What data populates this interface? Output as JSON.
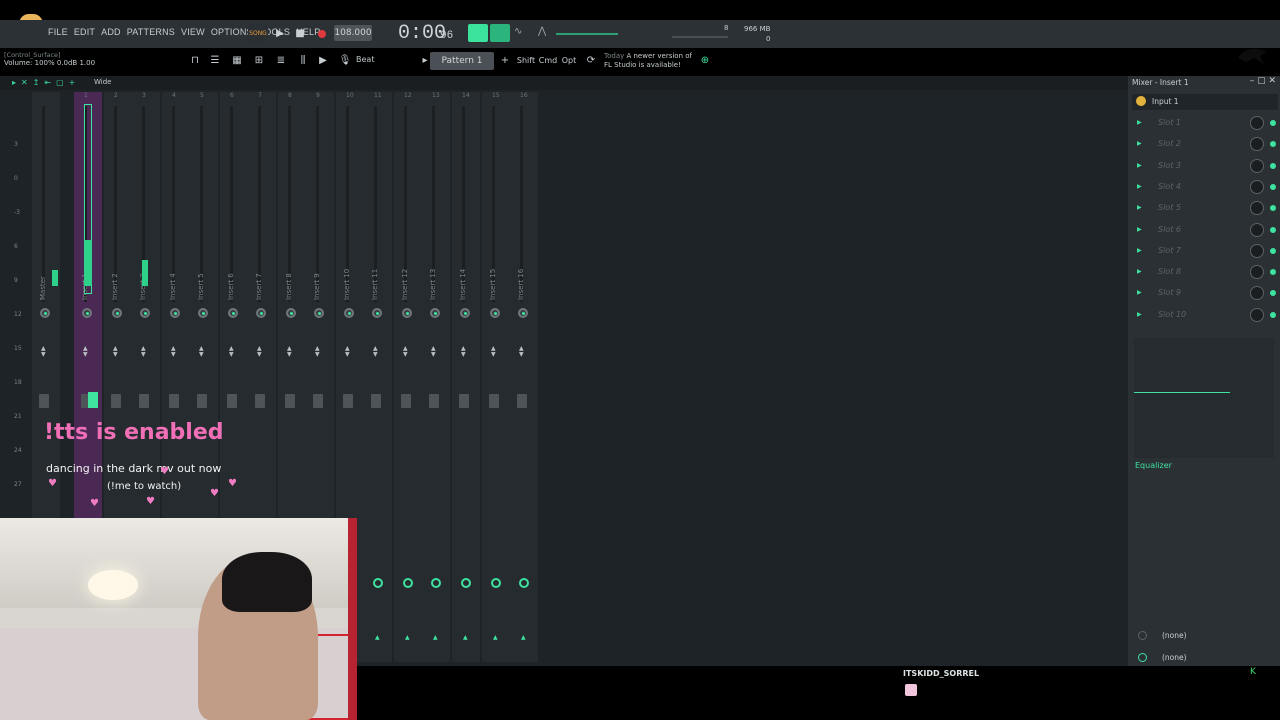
{
  "menu": [
    "FILE",
    "EDIT",
    "ADD",
    "PATTERNS",
    "VIEW",
    "OPTIONS",
    "TOOLS",
    "HELP"
  ],
  "transport": {
    "song_label": "SONG",
    "tempo": "108.000",
    "time": "0:00",
    "time_fraction": "96",
    "cpu": "8",
    "memory": "966 MB",
    "memory2": "0"
  },
  "hint": {
    "title": "[Control_Surface]",
    "values": "Volume: 100% 0.0dB 1.00"
  },
  "toolbar2": {
    "snap": "Beat",
    "pattern": "Pattern 1",
    "keys": [
      "Shift",
      "Cmd",
      "Opt"
    ],
    "news_day": "Today",
    "news_text1": "A newer version of",
    "news_text2": "FL Studio is available!"
  },
  "mixer": {
    "header_label": "Wide",
    "scale": [
      "3",
      "0",
      "-3",
      "6",
      "9",
      "12",
      "15",
      "18",
      "21",
      "24",
      "27"
    ],
    "strips": [
      "Master",
      "Insert 1",
      "Insert 2",
      "Insert 3",
      "Insert 4",
      "Insert 5",
      "Insert 6",
      "Insert 7",
      "Insert 8",
      "Insert 9",
      "Insert 10",
      "Insert 11",
      "Insert 12",
      "Insert 13",
      "Insert 14",
      "Insert 15",
      "Insert 16"
    ],
    "strip_numbers": [
      "",
      "1",
      "2",
      "3",
      "4",
      "5",
      "6",
      "7",
      "8",
      "9",
      "10",
      "11",
      "12",
      "13",
      "14",
      "15",
      "16"
    ]
  },
  "panel": {
    "title": "Mixer - Insert 1",
    "input": "Input 1",
    "slots": [
      "Slot 1",
      "Slot 2",
      "Slot 3",
      "Slot 4",
      "Slot 5",
      "Slot 6",
      "Slot 7",
      "Slot 8",
      "Slot 9",
      "Slot 10"
    ],
    "eq_label": "Equalizer",
    "route_in": "(none)",
    "route_out": "(none)"
  },
  "overlay": {
    "tts": "!tts is enabled",
    "promo": "dancing in the dark mv out now",
    "promo_cta": "(!me to watch)"
  },
  "chat": {
    "username": "ITSKIDD_SORREL"
  },
  "colors": {
    "accent": "#3ee3a0",
    "selected_strip": "#4a2a55",
    "tts_pink": "#f06fb6"
  }
}
